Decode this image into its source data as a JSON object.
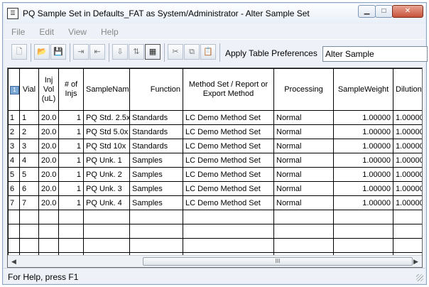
{
  "window": {
    "icon": "application-icon",
    "title": "PQ Sample Set in Defaults_FAT as System/Administrator - Alter Sample Set",
    "controls": {
      "minimize": "▁",
      "maximize": "□",
      "close": "✕"
    }
  },
  "menu": [
    "File",
    "Edit",
    "View",
    "Help"
  ],
  "toolbar": {
    "buttons": [
      {
        "icon": "new-icon",
        "glyph": "🗋"
      },
      {
        "icon": "open-folder-icon",
        "glyph": "📂"
      },
      {
        "icon": "save-icon",
        "glyph": "💾"
      },
      {
        "icon": "insert-row-icon",
        "glyph": "⇥"
      },
      {
        "icon": "append-row-icon",
        "glyph": "⇤"
      },
      {
        "icon": "fill-down-icon",
        "glyph": "⇩"
      },
      {
        "icon": "sort-icon",
        "glyph": "⇅"
      },
      {
        "icon": "table-prefs-icon",
        "glyph": "▦"
      },
      {
        "icon": "cut-icon",
        "glyph": "✂"
      },
      {
        "icon": "copy-icon",
        "glyph": "⧉"
      },
      {
        "icon": "paste-icon",
        "glyph": "📋"
      }
    ],
    "apply_label": "Apply Table Preferences",
    "preference_value": "Alter Sample"
  },
  "table": {
    "corner": "1",
    "headers": [
      "Vial",
      "Inj Vol (uL)",
      "# of Injs",
      "SampleName",
      "Function",
      "Method Set / Report or Export Method",
      "Processing",
      "SampleWeight",
      "Dilution"
    ],
    "rows": [
      {
        "n": "1",
        "cells": [
          "1",
          "20.0",
          "1",
          "PQ Std. 2.5x",
          "Standards",
          "LC Demo Method Set",
          "Normal",
          "1.00000",
          "1.00000"
        ]
      },
      {
        "n": "2",
        "cells": [
          "2",
          "20.0",
          "1",
          "PQ Std 5.0x",
          "Standards",
          "LC Demo Method Set",
          "Normal",
          "1.00000",
          "1.00000"
        ]
      },
      {
        "n": "3",
        "cells": [
          "3",
          "20.0",
          "1",
          "PQ Std 10x",
          "Standards",
          "LC Demo Method Set",
          "Normal",
          "1.00000",
          "1.00000"
        ]
      },
      {
        "n": "4",
        "cells": [
          "4",
          "20.0",
          "1",
          "PQ Unk. 1",
          "Samples",
          "LC Demo Method Set",
          "Normal",
          "1.00000",
          "1.00000"
        ]
      },
      {
        "n": "5",
        "cells": [
          "5",
          "20.0",
          "1",
          "PQ Unk. 2",
          "Samples",
          "LC Demo Method Set",
          "Normal",
          "1.00000",
          "1.00000"
        ]
      },
      {
        "n": "6",
        "cells": [
          "6",
          "20.0",
          "1",
          "PQ Unk. 3",
          "Samples",
          "LC Demo Method Set",
          "Normal",
          "1.00000",
          "1.00000"
        ]
      },
      {
        "n": "7",
        "cells": [
          "7",
          "20.0",
          "1",
          "PQ Unk. 4",
          "Samples",
          "LC Demo Method Set",
          "Normal",
          "1.00000",
          "1.00000"
        ]
      }
    ],
    "blank_rows": 4
  },
  "scrollbar": {
    "left_arrow": "◀",
    "right_arrow": "▶",
    "thumb_grip": "III"
  },
  "status": "For Help, press F1"
}
